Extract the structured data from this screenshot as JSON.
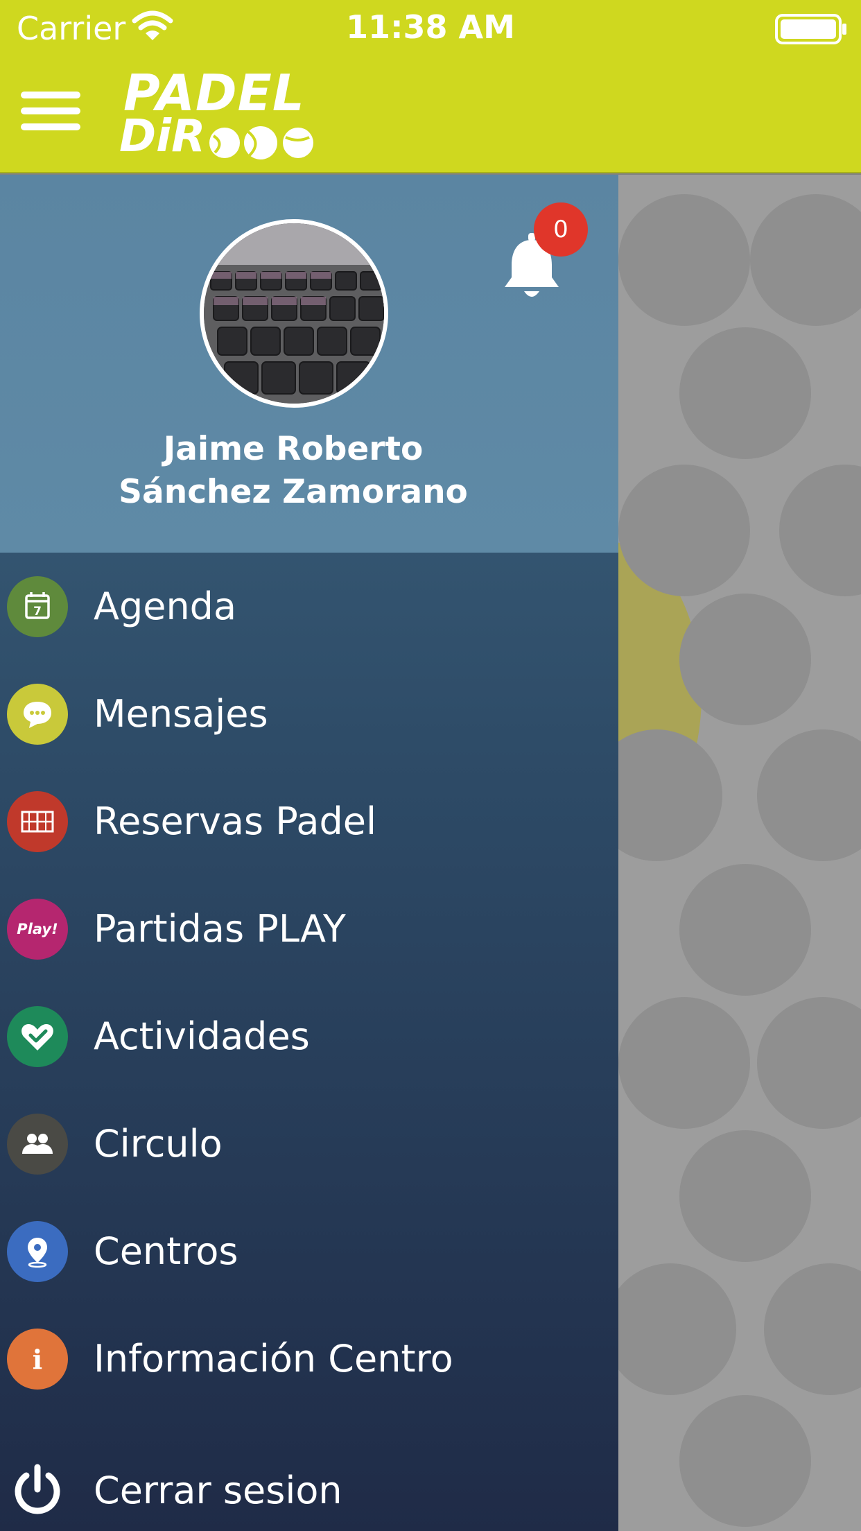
{
  "status_bar": {
    "carrier": "Carrier",
    "time": "11:38 AM"
  },
  "app": {
    "logo_line1": "PADEL",
    "logo_line2": "DiR"
  },
  "profile": {
    "name_line1": "Jaime Roberto",
    "name_line2": "Sánchez Zamorano",
    "notification_count": "0"
  },
  "menu": {
    "items": [
      {
        "label": "Agenda",
        "icon": "calendar-icon",
        "color": "#5f8a3c"
      },
      {
        "label": "Mensajes",
        "icon": "chat-icon",
        "color": "#c9c93a"
      },
      {
        "label": "Reservas Padel",
        "icon": "court-icon",
        "color": "#c0392b"
      },
      {
        "label": "Partidas PLAY",
        "icon": "play-icon",
        "color": "#b5266f",
        "icon_text": "Play!"
      },
      {
        "label": "Actividades",
        "icon": "heart-check-icon",
        "color": "#1e8a5a"
      },
      {
        "label": "Circulo",
        "icon": "people-icon",
        "color": "#4a4a45"
      },
      {
        "label": "Centros",
        "icon": "location-pin-icon",
        "color": "#3b6cc0"
      },
      {
        "label": "Información Centro",
        "icon": "info-icon",
        "color": "#e0743a",
        "icon_text": "i"
      }
    ],
    "logout_label": "Cerrar sesion"
  }
}
